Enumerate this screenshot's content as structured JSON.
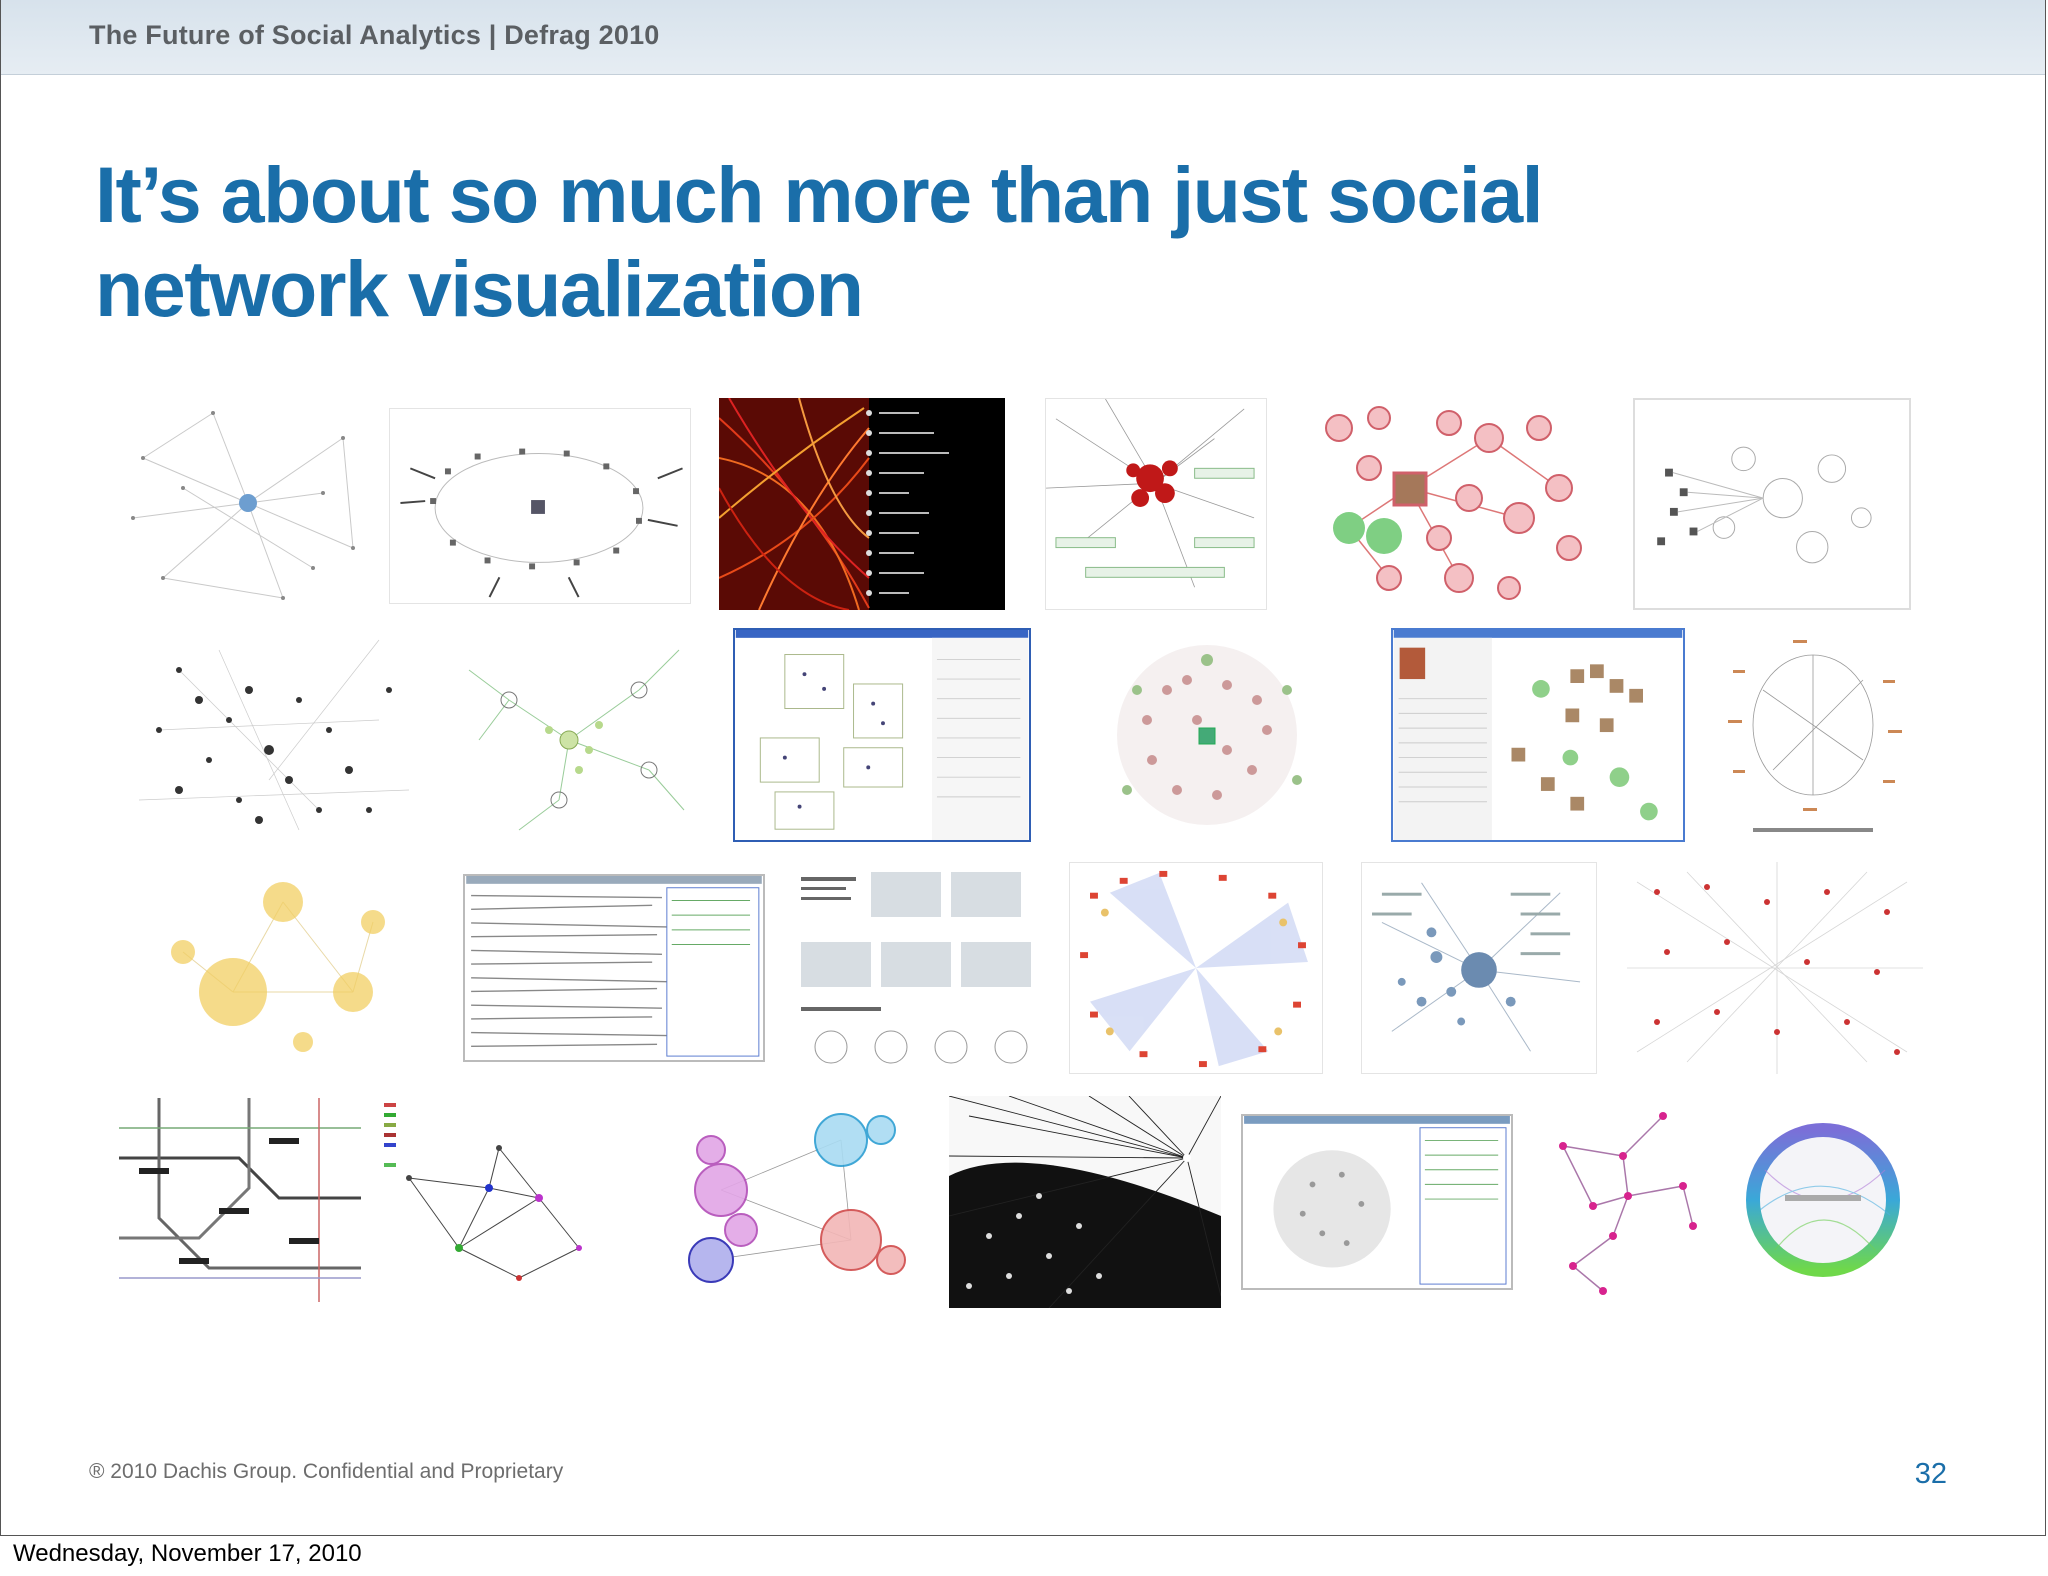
{
  "header": {
    "text": "The Future of Social Analytics | Defrag 2010"
  },
  "slide": {
    "title_line1": "It’s about so much more than just social",
    "title_line2": "network visualization",
    "footer_copyright": "® 2010 Dachis Group. Confidential and Proprietary",
    "page_number": "32"
  },
  "date_line": "Wednesday, November 17, 2010",
  "colors": {
    "title": "#1a6ea9",
    "header_bar": "#dde6ee",
    "page_number": "#1a6ea9"
  },
  "thumbnails": [
    {
      "name": "thumb-radial-network-blue",
      "style": "radial-gray"
    },
    {
      "name": "thumb-ellipse-photo-ring",
      "style": "ring"
    },
    {
      "name": "thumb-red-arc-names",
      "style": "dark-red"
    },
    {
      "name": "thumb-red-cluster-hairball",
      "style": "hairball-red"
    },
    {
      "name": "thumb-pink-photo-network",
      "style": "pink-bubbles"
    },
    {
      "name": "thumb-gray-cluster-circles",
      "style": "gray-circles"
    },
    {
      "name": "thumb-dark-node-cloud",
      "style": "dark-dots"
    },
    {
      "name": "thumb-green-tree-network",
      "style": "green-tree"
    },
    {
      "name": "thumb-app-window-clusters",
      "style": "window-blue"
    },
    {
      "name": "thumb-photo-sphere-network",
      "style": "photo-sphere"
    },
    {
      "name": "thumb-app-window-photos",
      "style": "window-photos"
    },
    {
      "name": "thumb-circular-label-network",
      "style": "circular-labels"
    },
    {
      "name": "thumb-yellow-clusters",
      "style": "yellow-clusters"
    },
    {
      "name": "thumb-dense-text-window",
      "style": "window-text"
    },
    {
      "name": "thumb-world-maps-grid",
      "style": "maps-grid"
    },
    {
      "name": "thumb-colorful-node-map",
      "style": "colorful-map"
    },
    {
      "name": "thumb-blue-bubble-network",
      "style": "blue-bubbles"
    },
    {
      "name": "thumb-red-dot-gray-network",
      "style": "red-dot-gray"
    },
    {
      "name": "thumb-subway-map",
      "style": "subway"
    },
    {
      "name": "thumb-colored-node-graph",
      "style": "colored-graph"
    },
    {
      "name": "thumb-magenta-cyan-bubbles",
      "style": "magenta-cyan"
    },
    {
      "name": "thumb-black-starburst",
      "style": "black-star"
    },
    {
      "name": "thumb-gray-network-window",
      "style": "window-gray"
    },
    {
      "name": "thumb-magenta-small-graph",
      "style": "small-graph"
    },
    {
      "name": "thumb-rainbow-circle",
      "style": "rainbow-circle"
    }
  ]
}
